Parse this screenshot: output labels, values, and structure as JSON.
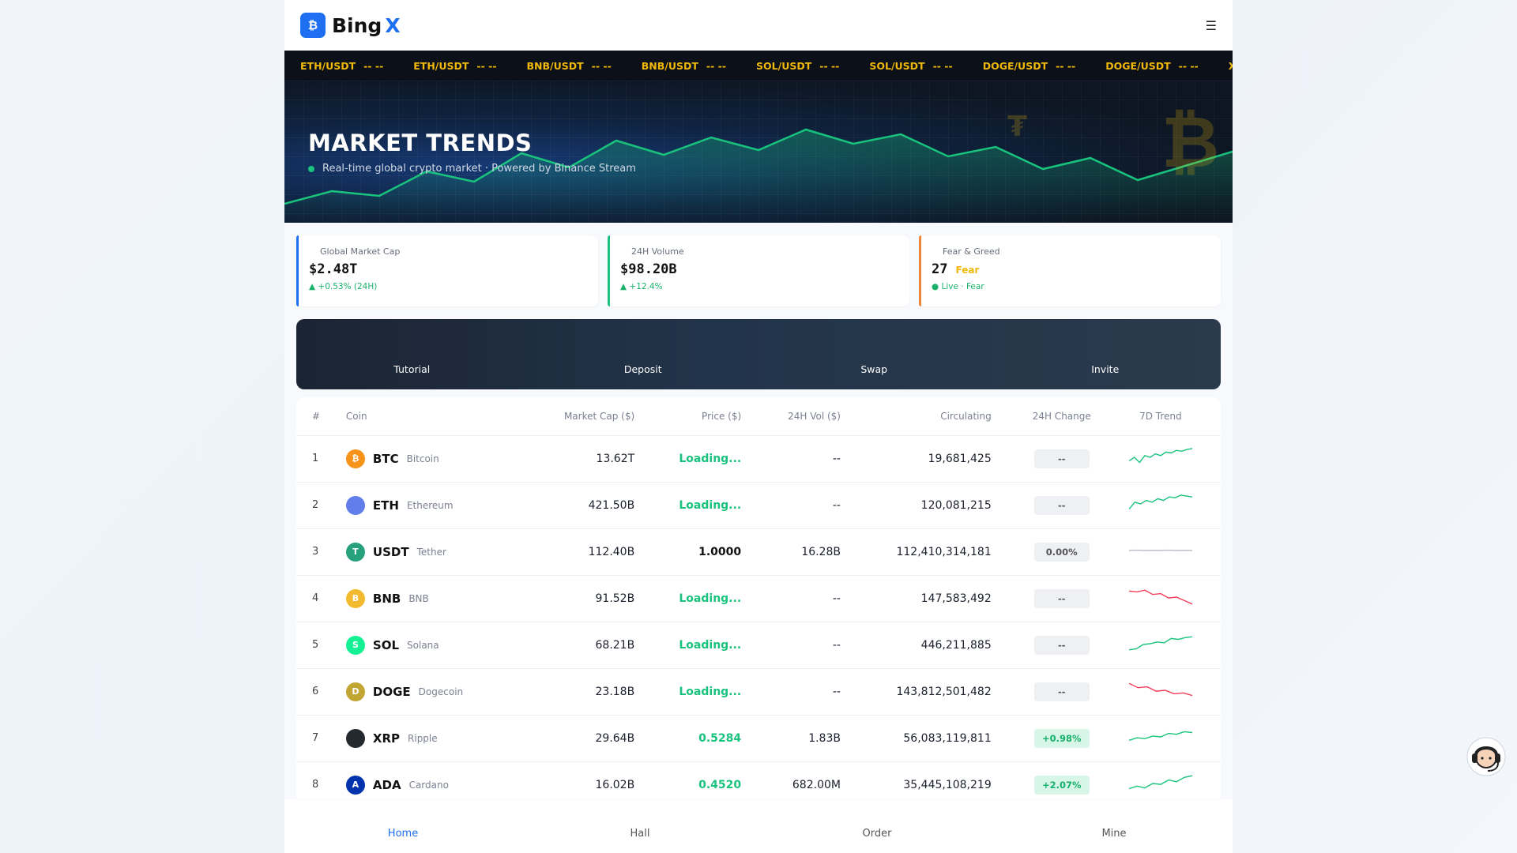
{
  "brand": {
    "logo_glyph": "₿",
    "name": "Bing",
    "accent": "X"
  },
  "header": {
    "menu_glyph": "☰"
  },
  "ticker": [
    {
      "pair": "ETH/USDT",
      "value": "-- --"
    },
    {
      "pair": "ETH/USDT",
      "value": "-- --"
    },
    {
      "pair": "BNB/USDT",
      "value": "-- --"
    },
    {
      "pair": "BNB/USDT",
      "value": "-- --"
    },
    {
      "pair": "SOL/USDT",
      "value": "-- --"
    },
    {
      "pair": "SOL/USDT",
      "value": "-- --"
    },
    {
      "pair": "DOGE/USDT",
      "value": "-- --"
    },
    {
      "pair": "DOGE/USDT",
      "value": "-- --"
    },
    {
      "pair": "XRP/USDT",
      "value": "-- --"
    }
  ],
  "hero": {
    "title": "MARKET TRENDS",
    "subtitle": "Real-time global crypto market · Powered by Binance Stream",
    "coin_glyph_1": "₮",
    "coin_glyph_2": "₿"
  },
  "stats": [
    {
      "label": "Global Market Cap",
      "value": "$2.48T",
      "sub": "▲ +0.53% (24H)",
      "accent": "#1e6ff2"
    },
    {
      "label": "24H Volume",
      "value": "$98.20B",
      "sub": "▲ +12.4%",
      "accent": "#19c37d"
    },
    {
      "label": "Fear & Greed",
      "value": "27",
      "word": "Fear",
      "sub": "● Live · Fear",
      "accent": "#f0863a"
    }
  ],
  "actions": [
    "Tutorial",
    "Deposit",
    "Swap",
    "Invite"
  ],
  "table": {
    "headers": [
      "#",
      "Coin",
      "Market Cap ($)",
      "Price ($)",
      "24H Vol ($)",
      "Circulating",
      "24H Change",
      "7D Trend"
    ],
    "rows": [
      {
        "rank": "1",
        "symbol": "BTC",
        "name": "Bitcoin",
        "icon_glyph": "₿",
        "icon_color": "#f7931a",
        "mcap": "13.62T",
        "price": "Loading...",
        "price_state": "loading",
        "vol": "--",
        "circ": "19,681,425",
        "change": "--",
        "change_state": "neutral",
        "trend": [
          0.3,
          0.5,
          0.2,
          0.6,
          0.5,
          0.7,
          0.6,
          0.8,
          0.75,
          0.9,
          0.85,
          0.95,
          1.0
        ],
        "trend_color": "#19c37d"
      },
      {
        "rank": "2",
        "symbol": "ETH",
        "name": "Ethereum",
        "icon_glyph": "",
        "icon_color": "#627eea",
        "mcap": "421.50B",
        "price": "Loading...",
        "price_state": "loading",
        "vol": "--",
        "circ": "120,081,215",
        "change": "--",
        "change_state": "neutral",
        "trend": [
          0.2,
          0.6,
          0.5,
          0.7,
          0.6,
          0.8,
          0.7,
          0.9,
          0.85,
          1.0,
          0.95,
          0.9
        ],
        "trend_color": "#19c37d"
      },
      {
        "rank": "3",
        "symbol": "USDT",
        "name": "Tether",
        "icon_glyph": "T",
        "icon_color": "#26a17b",
        "mcap": "112.40B",
        "price": "1.0000",
        "price_state": "plain",
        "vol": "16.28B",
        "circ": "112,410,314,181",
        "change": "0.00%",
        "change_state": "neutral",
        "trend": [
          0.5,
          0.52,
          0.5,
          0.51,
          0.5,
          0.52,
          0.5,
          0.51,
          0.5
        ],
        "trend_color": "#b8bdc6"
      },
      {
        "rank": "4",
        "symbol": "BNB",
        "name": "BNB",
        "icon_glyph": "B",
        "icon_color": "#f3ba2f",
        "mcap": "91.52B",
        "price": "Loading...",
        "price_state": "loading",
        "vol": "--",
        "circ": "147,583,492",
        "change": "--",
        "change_state": "neutral",
        "trend": [
          0.85,
          0.8,
          0.9,
          0.65,
          0.7,
          0.45,
          0.5,
          0.3,
          0.1
        ],
        "trend_color": "#f23c5a"
      },
      {
        "rank": "5",
        "symbol": "SOL",
        "name": "Solana",
        "icon_glyph": "S",
        "icon_color": "#14f195",
        "mcap": "68.21B",
        "price": "Loading...",
        "price_state": "loading",
        "vol": "--",
        "circ": "446,211,885",
        "change": "--",
        "change_state": "neutral",
        "trend": [
          0.15,
          0.2,
          0.45,
          0.5,
          0.6,
          0.55,
          0.8,
          0.75,
          0.85,
          0.9
        ],
        "trend_color": "#19c37d"
      },
      {
        "rank": "6",
        "symbol": "DOGE",
        "name": "Dogecoin",
        "icon_glyph": "D",
        "icon_color": "#c2a633",
        "mcap": "23.18B",
        "price": "Loading...",
        "price_state": "loading",
        "vol": "--",
        "circ": "143,812,501,482",
        "change": "--",
        "change_state": "neutral",
        "trend": [
          0.9,
          0.65,
          0.7,
          0.45,
          0.5,
          0.3,
          0.35,
          0.2
        ],
        "trend_color": "#f23c5a"
      },
      {
        "rank": "7",
        "symbol": "XRP",
        "name": "Ripple",
        "icon_glyph": "",
        "icon_color": "#23292f",
        "mcap": "29.64B",
        "price": "0.5284",
        "price_state": "up",
        "vol": "1.83B",
        "circ": "56,083,119,811",
        "change": "+0.98%",
        "change_state": "up",
        "trend": [
          0.3,
          0.45,
          0.4,
          0.55,
          0.5,
          0.7,
          0.65,
          0.8,
          0.75
        ],
        "trend_color": "#19c37d"
      },
      {
        "rank": "8",
        "symbol": "ADA",
        "name": "Cardano",
        "icon_glyph": "A",
        "icon_color": "#0033ad",
        "mcap": "16.02B",
        "price": "0.4520",
        "price_state": "up",
        "vol": "682.00M",
        "circ": "35,445,108,219",
        "change": "+2.07%",
        "change_state": "up",
        "trend": [
          0.2,
          0.35,
          0.25,
          0.5,
          0.45,
          0.7,
          0.6,
          0.85,
          0.95
        ],
        "trend_color": "#19c37d"
      }
    ]
  },
  "bottom_nav": [
    {
      "label": "Home",
      "active": true
    },
    {
      "label": "Hall",
      "active": false
    },
    {
      "label": "Order",
      "active": false
    },
    {
      "label": "Mine",
      "active": false
    }
  ]
}
